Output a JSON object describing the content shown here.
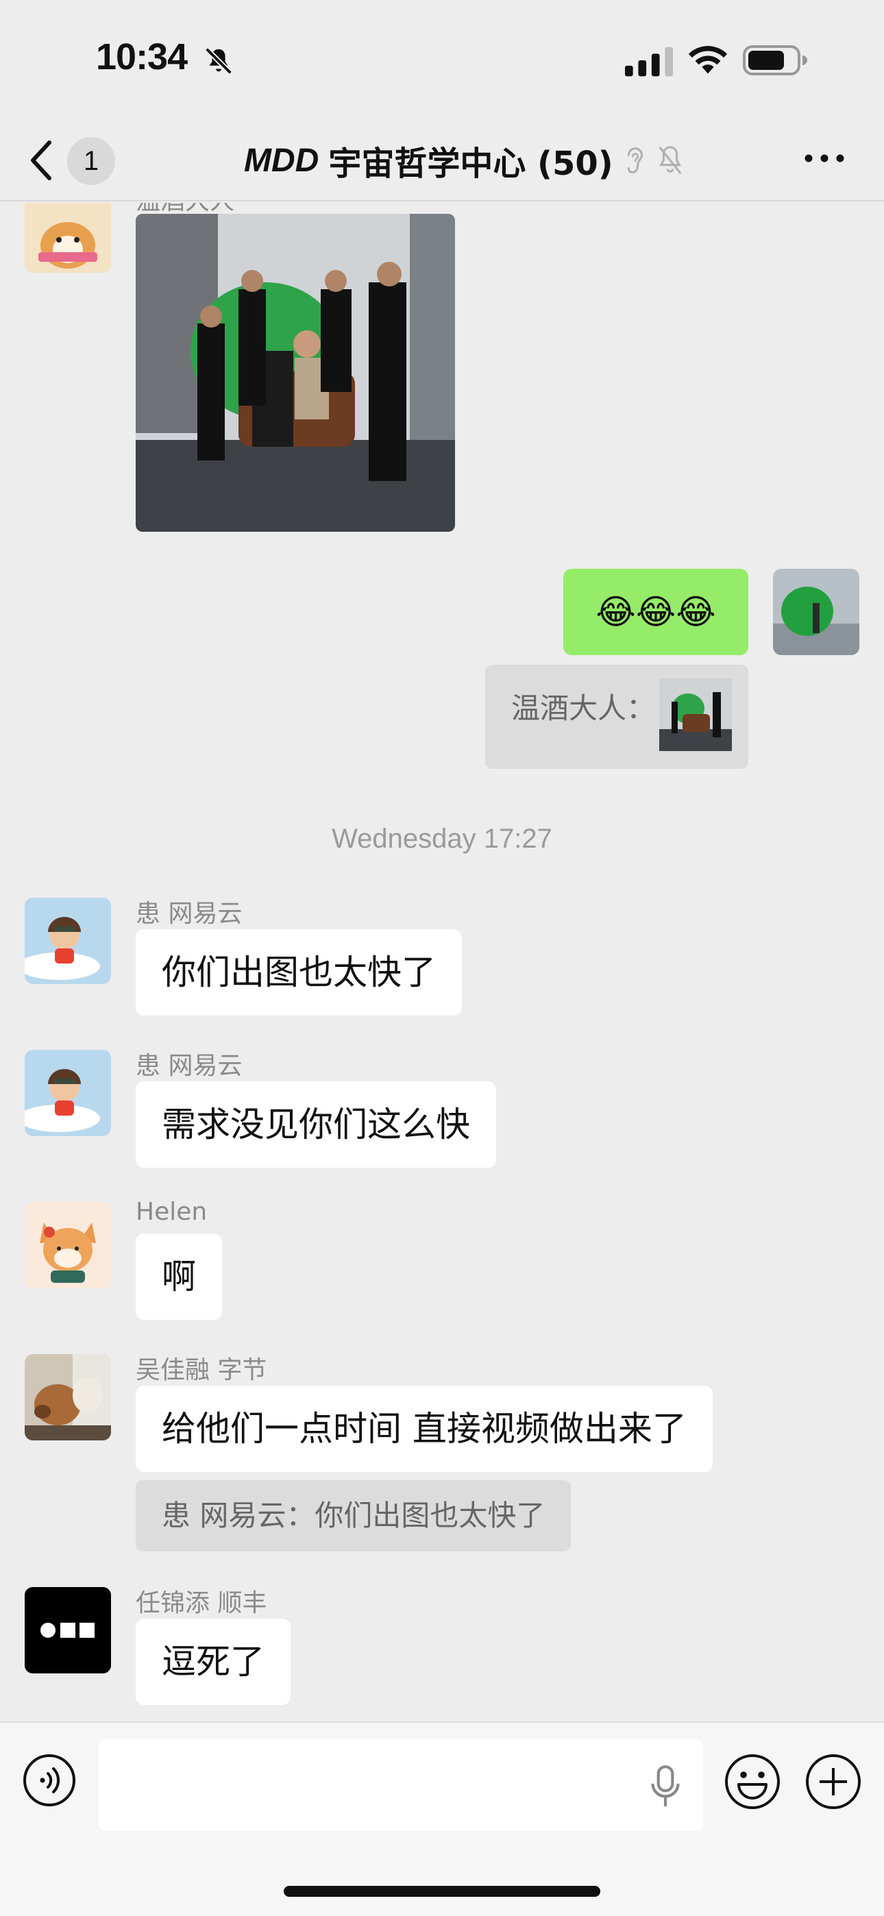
{
  "status_bar": {
    "time": "10:34"
  },
  "nav": {
    "back_count": "1",
    "title_prefix": "MDD",
    "title": "宇宙哲学中心 (50)"
  },
  "messages": [
    {
      "sender": "温酒大人",
      "type": "image",
      "image_desc": "people in black shirts serving a woman on a leather sofa beside a green sphere"
    },
    {
      "sender": "me",
      "text": "😂😂😂",
      "quote": {
        "author": "温酒大人：",
        "type": "image"
      }
    },
    {
      "timestamp": "Wednesday 17:27"
    },
    {
      "sender": "患 网易云",
      "text": "你们出图也太快了"
    },
    {
      "sender": "患 网易云",
      "text": "需求没见你们这么快"
    },
    {
      "sender": "Helen",
      "text": "啊"
    },
    {
      "sender": "吴佳融 字节",
      "text": "给他们一点时间 直接视频做出来了",
      "quote": "患 网易云：你们出图也太快了"
    },
    {
      "sender": "任锦添 顺丰",
      "text": "逗死了"
    }
  ],
  "input": {
    "placeholder": ""
  },
  "colors": {
    "background": "#ededed",
    "own_bubble": "#95ec69",
    "other_bubble": "#ffffff",
    "quote_bg": "#dcdcdc",
    "name_gray": "#8a8a8a"
  },
  "icons": [
    "bell-slash-icon",
    "signal-icon",
    "wifi-icon",
    "battery-icon",
    "chevron-left-icon",
    "ear-icon",
    "more-icon",
    "voice-icon",
    "microphone-icon",
    "emoji-icon",
    "plus-icon"
  ]
}
